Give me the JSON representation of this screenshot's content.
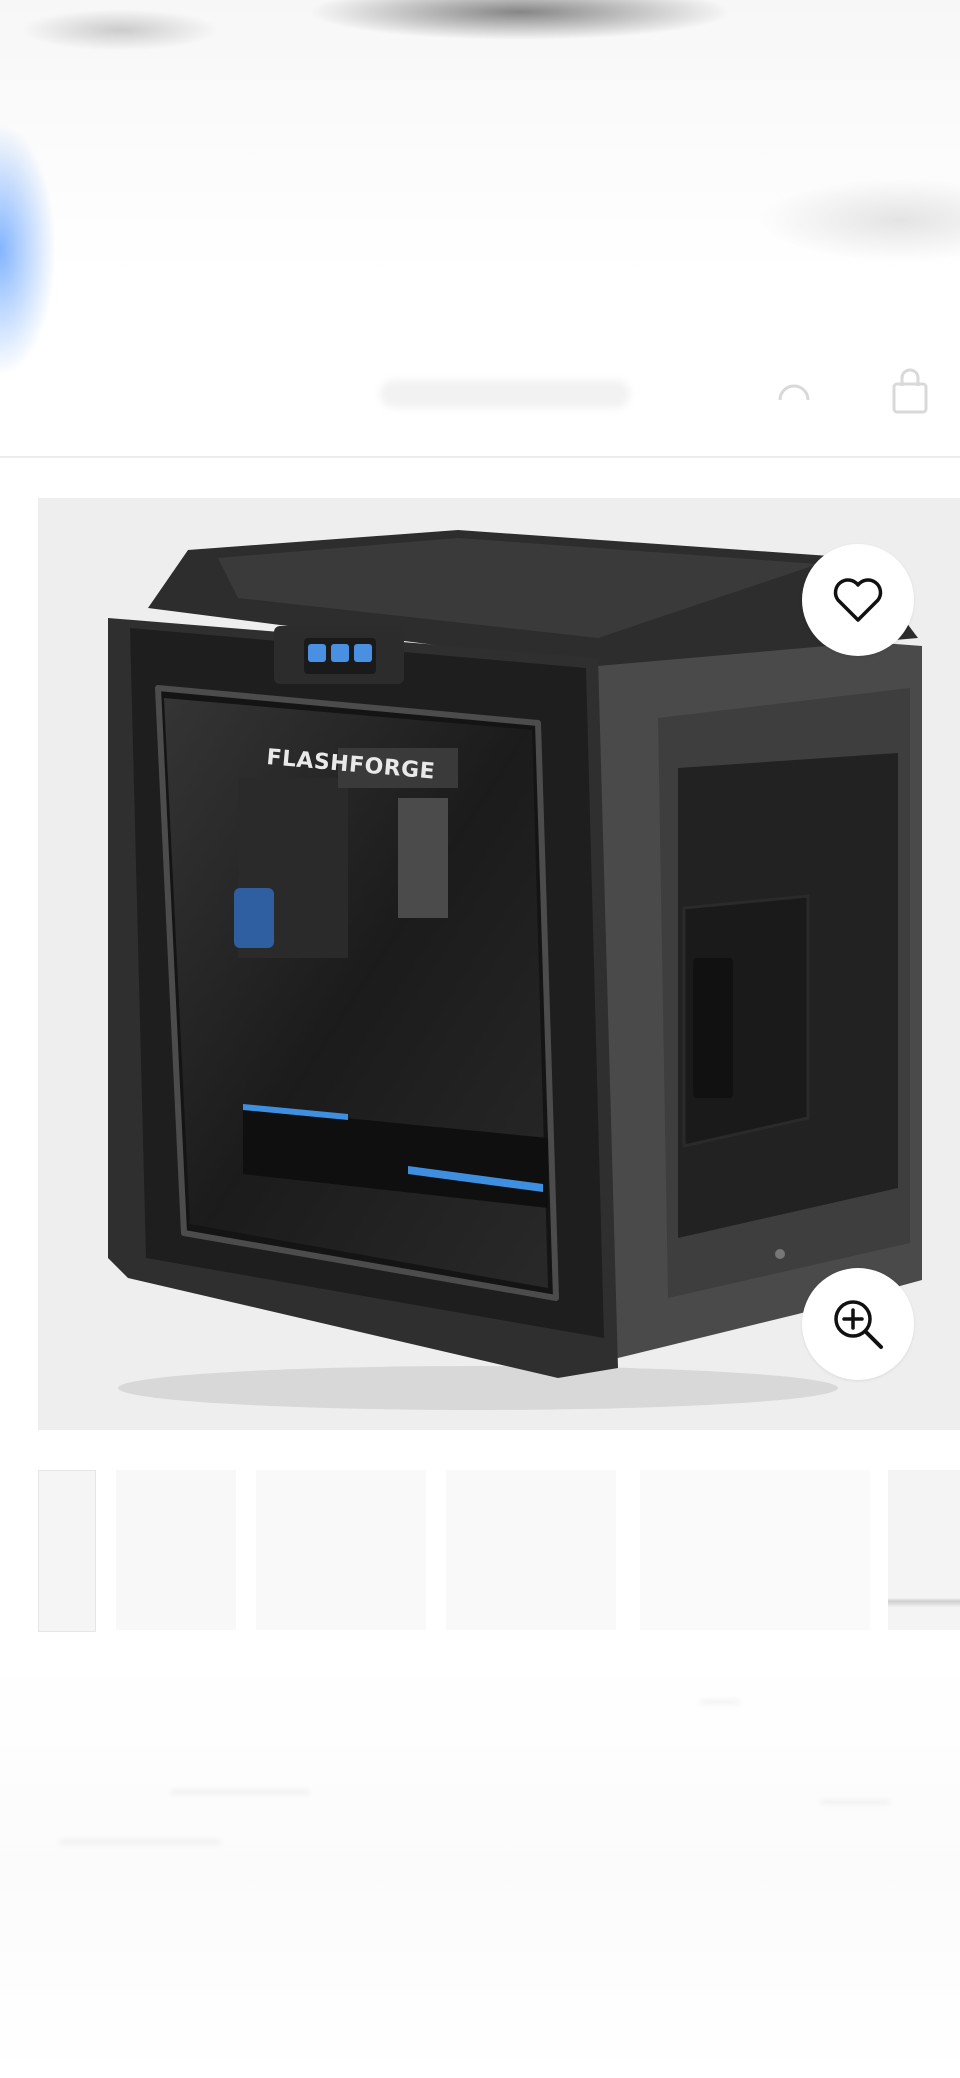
{
  "product": {
    "brand_label": "FLASHFORGE",
    "image_icon": "3d-printer-image"
  },
  "header": {
    "account_icon": "account-icon",
    "bag_icon": "shopping-bag-icon"
  },
  "actions": {
    "wishlist_icon": "heart-icon",
    "zoom_icon": "zoom-in-icon"
  },
  "colors": {
    "page_bg": "#ffffff",
    "image_bg": "#eeeeee",
    "printer_body": "#3a3a3a",
    "accent_blue": "#2f7fd6"
  }
}
